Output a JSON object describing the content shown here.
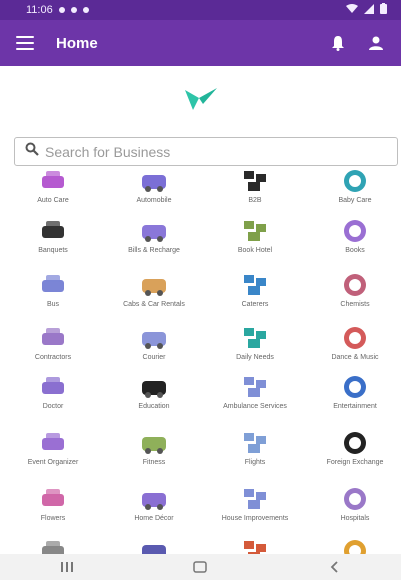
{
  "status_bar": {
    "time": "11:06"
  },
  "app_bar": {
    "title": "Home"
  },
  "search": {
    "placeholder": "Search for Business"
  },
  "categories": [
    {
      "label": "Auto Care",
      "icon": "car-wash-icon",
      "color": "#b55ad0"
    },
    {
      "label": "Automobile",
      "icon": "car-icon",
      "color": "#7b6fd6"
    },
    {
      "label": "B2B",
      "icon": "boxes-icon",
      "color": "#2a2a2a"
    },
    {
      "label": "Baby Care",
      "icon": "baby-icon",
      "color": "#2fa3b4"
    },
    {
      "label": "Banquets",
      "icon": "building-icon",
      "color": "#333333"
    },
    {
      "label": "Bills & Recharge",
      "icon": "bill-icon",
      "color": "#8a77d9"
    },
    {
      "label": "Book Hotel",
      "icon": "hotel-icon",
      "color": "#7fa04a"
    },
    {
      "label": "Books",
      "icon": "book-icon",
      "color": "#9a6fd3"
    },
    {
      "label": "Bus",
      "icon": "bus-icon",
      "color": "#7b85d6"
    },
    {
      "label": "Cabs & Car Rentals",
      "icon": "taxi-icon",
      "color": "#d9a15a"
    },
    {
      "label": "Caterers",
      "icon": "chef-icon",
      "color": "#3a86c8"
    },
    {
      "label": "Chemists",
      "icon": "medicine-icon",
      "color": "#c0607a"
    },
    {
      "label": "Contractors",
      "icon": "worker-icon",
      "color": "#9a78c8"
    },
    {
      "label": "Courier",
      "icon": "delivery-truck-icon",
      "color": "#8b95d9"
    },
    {
      "label": "Daily Needs",
      "icon": "basket-icon",
      "color": "#2aa7a0"
    },
    {
      "label": "Dance & Music",
      "icon": "dancer-icon",
      "color": "#d45a5a"
    },
    {
      "label": "Doctor",
      "icon": "doctor-icon",
      "color": "#8a6fd0"
    },
    {
      "label": "Education",
      "icon": "graduation-cap-icon",
      "color": "#222222"
    },
    {
      "label": "Ambulance Services",
      "icon": "ambulance-icon",
      "color": "#7f8fd6"
    },
    {
      "label": "Entertainment",
      "icon": "theater-icon",
      "color": "#3a6fc8"
    },
    {
      "label": "Event Organizer",
      "icon": "calendar-icon",
      "color": "#9a6fd3"
    },
    {
      "label": "Fitness",
      "icon": "fitness-icon",
      "color": "#8fb05a"
    },
    {
      "label": "Flights",
      "icon": "airplane-icon",
      "color": "#7f9fd6"
    },
    {
      "label": "Foreign Exchange",
      "icon": "currency-exchange-icon",
      "color": "#222222"
    },
    {
      "label": "Flowers",
      "icon": "flower-icon",
      "color": "#d067a8"
    },
    {
      "label": "Home Décor",
      "icon": "home-decor-icon",
      "color": "#8a6fd3"
    },
    {
      "label": "House Improvements",
      "icon": "house-improvement-icon",
      "color": "#7f8fd6"
    },
    {
      "label": "Hospitals",
      "icon": "hospital-icon",
      "color": "#9a78c8"
    },
    {
      "label": "",
      "icon": "partial-icon-1",
      "color": "#888888"
    },
    {
      "label": "",
      "icon": "partial-icon-2",
      "color": "#5a5ab0"
    },
    {
      "label": "",
      "icon": "partial-icon-3",
      "color": "#d45a3a"
    },
    {
      "label": "",
      "icon": "partial-icon-4",
      "color": "#e0a030"
    }
  ],
  "colors": {
    "status_bar": "#5b2a96",
    "app_bar": "#6d35a8",
    "logo": "#2ec4a8"
  }
}
